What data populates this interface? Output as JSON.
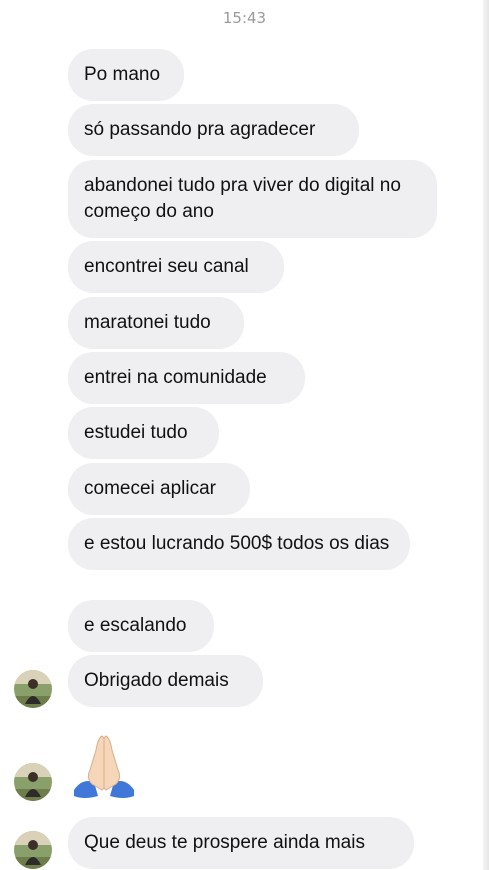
{
  "header": {
    "time": "15:43"
  },
  "messages": [
    {
      "text": "Po mano"
    },
    {
      "text": "só passando pra agradecer"
    },
    {
      "text": "abandonei tudo pra viver do digital no começo do ano"
    },
    {
      "text": "encontrei seu canal"
    },
    {
      "text": "maratonei tudo"
    },
    {
      "text": "entrei na comunidade"
    },
    {
      "text": "estudei tudo"
    },
    {
      "text": "comecei aplicar"
    },
    {
      "text": "e estou lucrando 500$ todos os dias"
    },
    {
      "text": "e escalando"
    },
    {
      "text": "Obrigado demais"
    },
    {
      "text": "Que deus te prospere ainda mais"
    }
  ],
  "reaction": {
    "icon": "folded-hands-icon"
  },
  "colors": {
    "bubble": "#efeff2",
    "text": "#111111",
    "timestamp": "#9a9a9a"
  }
}
